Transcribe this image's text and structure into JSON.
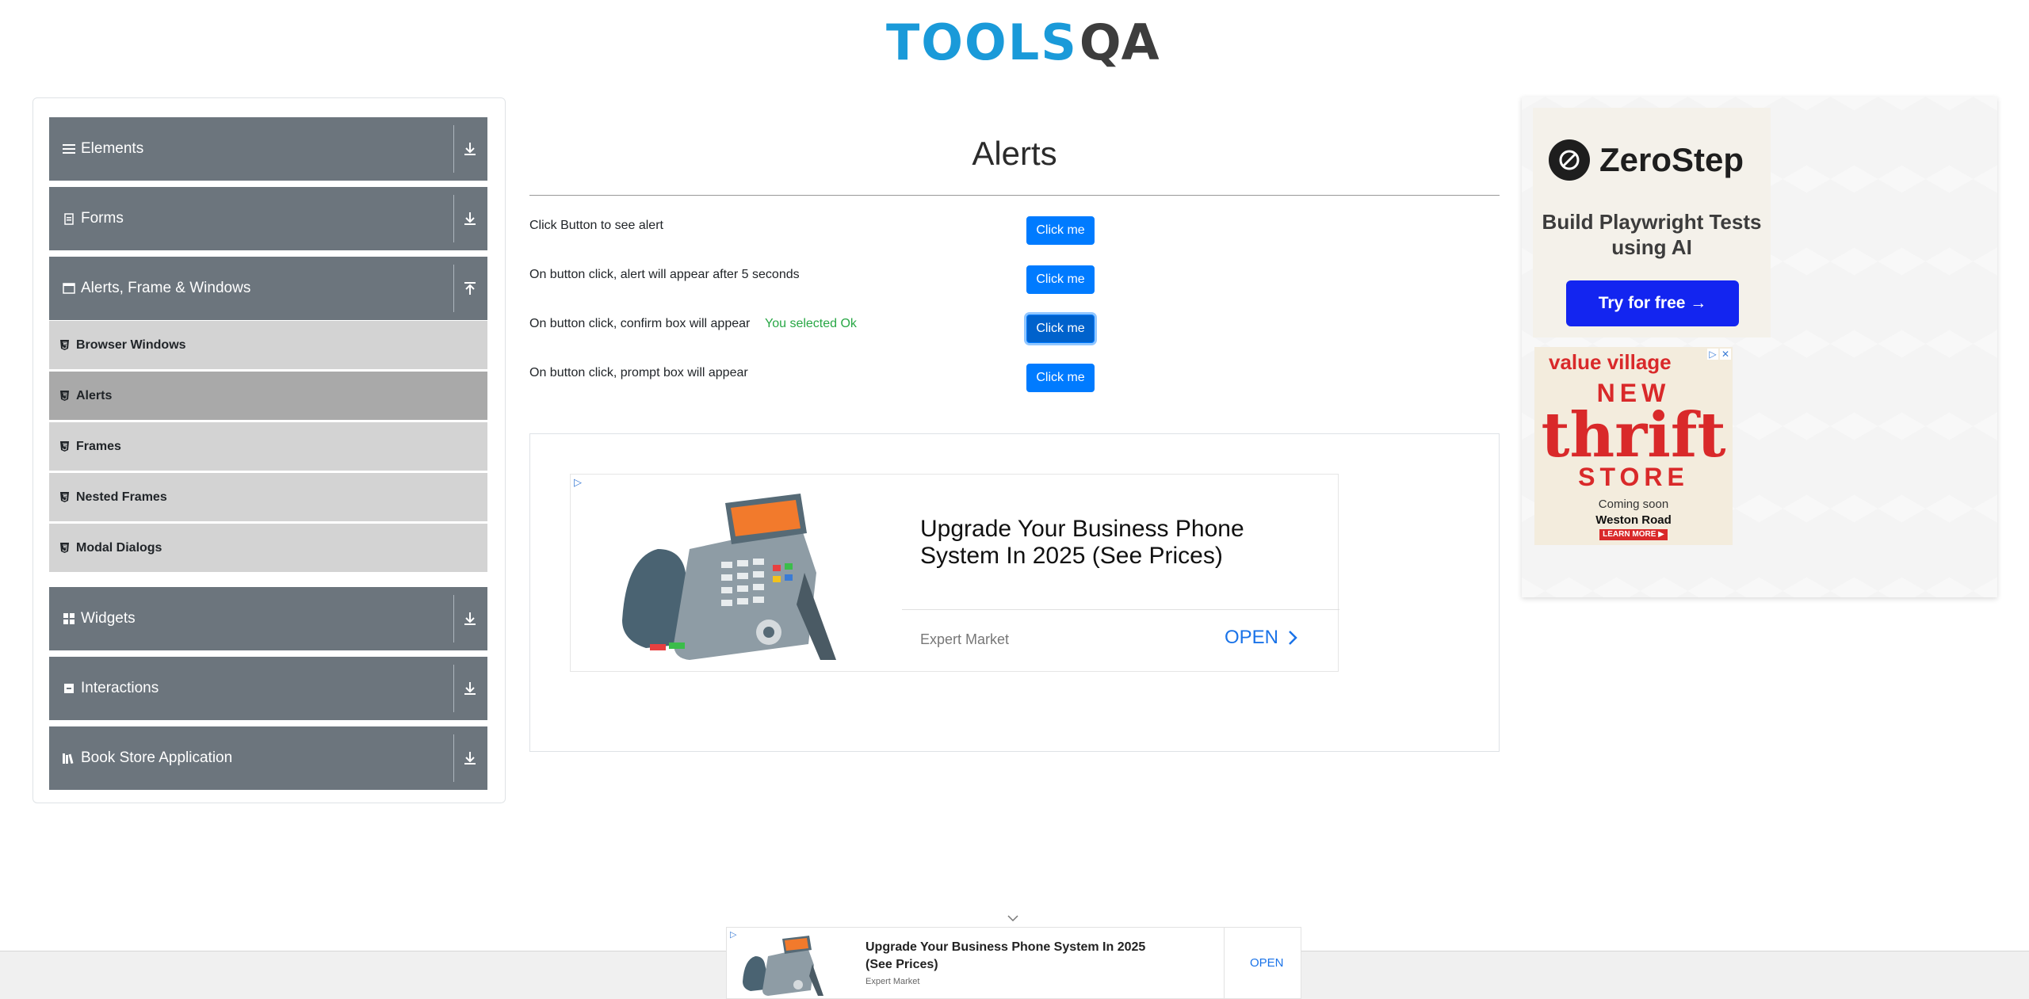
{
  "header": {
    "logo_text_primary": "TOOLS",
    "logo_text_secondary": "QA",
    "brand_color_primary": "#1a9ad9",
    "brand_color_secondary": "#3d3d3d"
  },
  "sidebar": {
    "groups": [
      {
        "label": "Elements",
        "icon": "list-icon",
        "expanded": false
      },
      {
        "label": "Forms",
        "icon": "form-icon",
        "expanded": false
      },
      {
        "label": "Alerts, Frame & Windows",
        "icon": "window-icon",
        "expanded": true
      },
      {
        "label": "Widgets",
        "icon": "grid-icon",
        "expanded": false
      },
      {
        "label": "Interactions",
        "icon": "interaction-icon",
        "expanded": false
      },
      {
        "label": "Book Store Application",
        "icon": "books-icon",
        "expanded": false
      }
    ],
    "sub_items": [
      {
        "label": "Browser Windows",
        "active": false
      },
      {
        "label": "Alerts",
        "active": true
      },
      {
        "label": "Frames",
        "active": false
      },
      {
        "label": "Nested Frames",
        "active": false
      },
      {
        "label": "Modal Dialogs",
        "active": false
      }
    ],
    "header_color": "#6c757d",
    "sub_item_color": "#d3d3d3",
    "active_sub_item_color": "#a9a9a9"
  },
  "main": {
    "title": "Alerts",
    "rows": [
      {
        "label": "Click Button to see alert",
        "button": "Click me"
      },
      {
        "label": "On button click, alert will appear after 5 seconds",
        "button": "Click me"
      },
      {
        "label": "On button click, confirm box will appear",
        "button": "Click me",
        "result": "You selected Ok"
      },
      {
        "label": "On button click, prompt box will appear",
        "button": "Click me"
      }
    ],
    "button_color": "#007bff",
    "result_color": "#28a745"
  },
  "content_ad": {
    "headline": "Upgrade Your Business Phone System In 2025 (See Prices)",
    "advertiser": "Expert Market",
    "cta": "OPEN",
    "adchoices_icon": "adchoices-icon"
  },
  "right_ad": {
    "zerostep": {
      "brand": "ZeroStep",
      "tagline": "Build Playwright Tests using AI",
      "cta": "Try for free →"
    },
    "value_village": {
      "brand": "value village",
      "line1": "NEW",
      "line2": "thrift",
      "line3": "STORE",
      "line4": "Coming soon",
      "line5": "Weston Road",
      "cta": "LEARN MORE ▶"
    }
  },
  "sticky_ad": {
    "headline": "Upgrade Your Business Phone System In 2025 (See Prices)",
    "advertiser": "Expert Market",
    "cta": "OPEN"
  }
}
